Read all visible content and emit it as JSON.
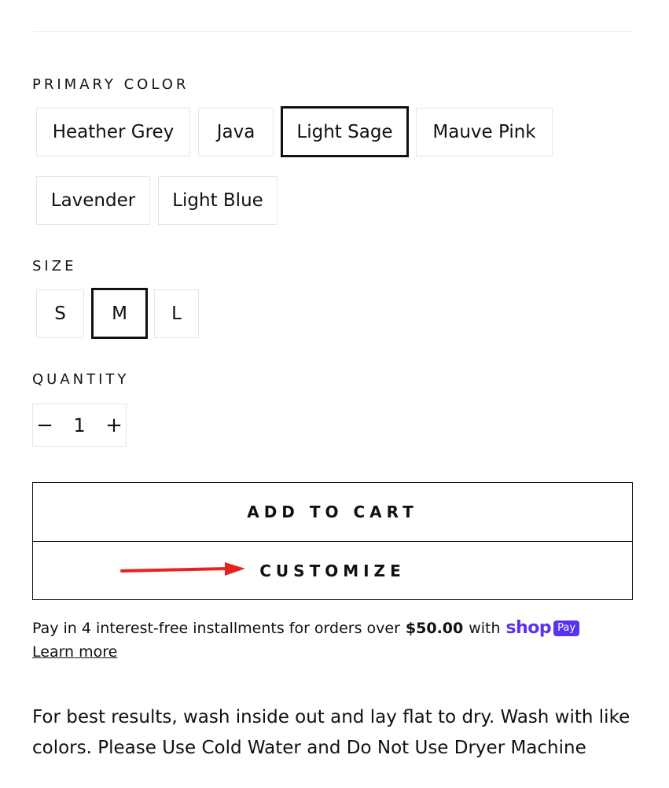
{
  "primary_color": {
    "label": "PRIMARY COLOR",
    "options": [
      {
        "label": "Heather Grey",
        "selected": false
      },
      {
        "label": "Java",
        "selected": false
      },
      {
        "label": "Light Sage",
        "selected": true
      },
      {
        "label": "Mauve Pink",
        "selected": false
      },
      {
        "label": "Lavender",
        "selected": false
      },
      {
        "label": "Light Blue",
        "selected": false
      }
    ]
  },
  "size": {
    "label": "SIZE",
    "options": [
      {
        "label": "S",
        "selected": false
      },
      {
        "label": "M",
        "selected": true
      },
      {
        "label": "L",
        "selected": false
      }
    ]
  },
  "quantity": {
    "label": "QUANTITY",
    "minus": "−",
    "value": "1",
    "plus": "+"
  },
  "buttons": {
    "add_to_cart": "ADD TO CART",
    "customize": "CUSTOMIZE"
  },
  "annotation": {
    "arrow_color": "#e8231f"
  },
  "shop_pay": {
    "text_before": "Pay in 4 interest-free installments for orders over",
    "amount": "$50.00",
    "text_after": "with",
    "logo_text": "shop",
    "badge_text": "Pay",
    "brand_color": "#5a31f4",
    "learn_more": "Learn more"
  },
  "care": {
    "text": "For best results, wash inside out and lay flat to dry. Wash with like colors. Please Use Cold Water and Do Not Use Dryer Machine"
  }
}
